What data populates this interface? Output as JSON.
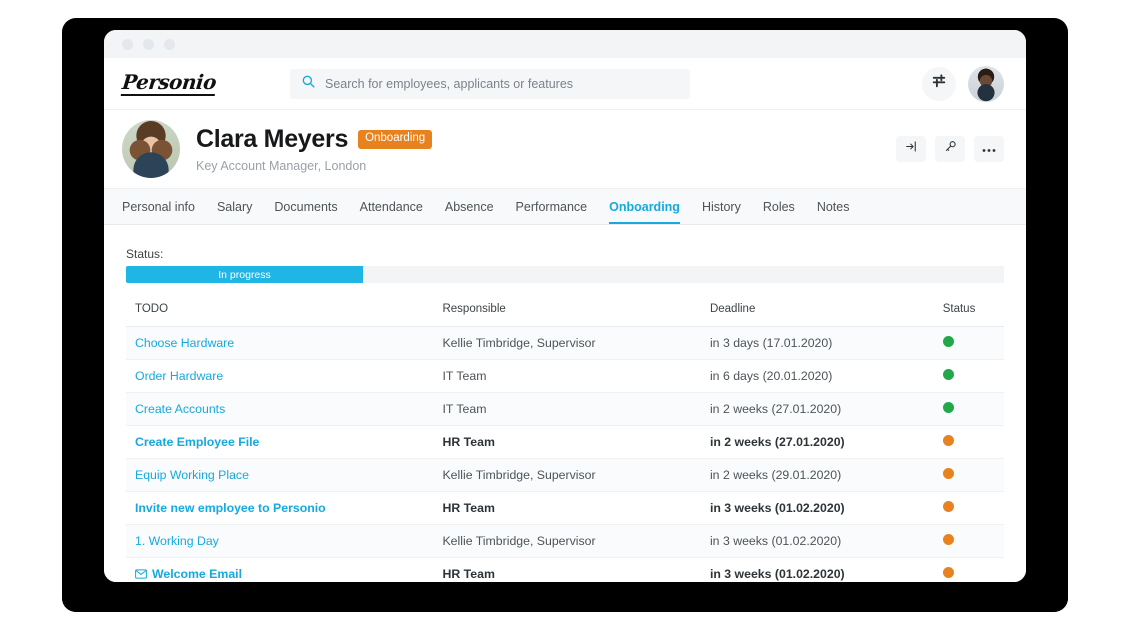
{
  "window": {
    "dots": [
      "dot-1",
      "dot-2",
      "dot-3"
    ]
  },
  "appbar": {
    "logo": "Personio",
    "search": {
      "icon": "search-icon",
      "placeholder": "Search for employees, applicants or features",
      "value": ""
    },
    "settings_icon": "sliders-icon",
    "user_avatar": "user-avatar"
  },
  "profile": {
    "avatar": "employee-avatar",
    "name": "Clara Meyers",
    "badge": "Onboarding",
    "subtitle": "Key Account Manager, London",
    "actions": [
      {
        "name": "login-as-button",
        "icon": "arrow-into-door-icon"
      },
      {
        "name": "reset-password-button",
        "icon": "key-icon"
      },
      {
        "name": "more-options-button",
        "icon": "ellipsis-icon"
      }
    ]
  },
  "tabs": [
    {
      "label": "Personal info",
      "active": false
    },
    {
      "label": "Salary",
      "active": false
    },
    {
      "label": "Documents",
      "active": false
    },
    {
      "label": "Attendance",
      "active": false
    },
    {
      "label": "Absence",
      "active": false
    },
    {
      "label": "Performance",
      "active": false
    },
    {
      "label": "Onboarding",
      "active": true
    },
    {
      "label": "History",
      "active": false
    },
    {
      "label": "Roles",
      "active": false
    },
    {
      "label": "Notes",
      "active": false
    }
  ],
  "status": {
    "label": "Status:",
    "progress_text": "In progress",
    "progress_percent": 27
  },
  "table": {
    "headers": [
      "TODO",
      "Responsible",
      "Deadline",
      "Status"
    ],
    "rows": [
      {
        "todo": "Choose Hardware",
        "responsible": "Kellie Timbridge, Supervisor",
        "deadline": "in 3 days (17.01.2020)",
        "status": "green",
        "bold": false,
        "mail": false
      },
      {
        "todo": "Order Hardware",
        "responsible": "IT Team",
        "deadline": "in 6 days (20.01.2020)",
        "status": "green",
        "bold": false,
        "mail": false
      },
      {
        "todo": "Create Accounts",
        "responsible": "IT Team",
        "deadline": "in 2 weeks (27.01.2020)",
        "status": "green",
        "bold": false,
        "mail": false
      },
      {
        "todo": "Create Employee File",
        "responsible": "HR Team",
        "deadline": "in 2 weeks (27.01.2020)",
        "status": "orange",
        "bold": true,
        "mail": false
      },
      {
        "todo": "Equip Working Place",
        "responsible": "Kellie Timbridge, Supervisor",
        "deadline": "in 2 weeks (29.01.2020)",
        "status": "orange",
        "bold": false,
        "mail": false
      },
      {
        "todo": "Invite new employee to Personio",
        "responsible": "HR Team",
        "deadline": "in 3 weeks (01.02.2020)",
        "status": "orange",
        "bold": true,
        "mail": false
      },
      {
        "todo": "1. Working Day",
        "responsible": "Kellie Timbridge, Supervisor",
        "deadline": "in 3 weeks (01.02.2020)",
        "status": "orange",
        "bold": false,
        "mail": false
      },
      {
        "todo": "Welcome Email",
        "responsible": "HR Team",
        "deadline": "in 3 weeks (01.02.2020)",
        "status": "orange",
        "bold": true,
        "mail": true
      }
    ]
  },
  "colors": {
    "accent": "#16a9de",
    "progress_fill": "#1fb5e5",
    "badge_orange": "#e8821e",
    "status_green": "#22a84a",
    "status_orange": "#e8821e",
    "bezel": "#000000"
  }
}
